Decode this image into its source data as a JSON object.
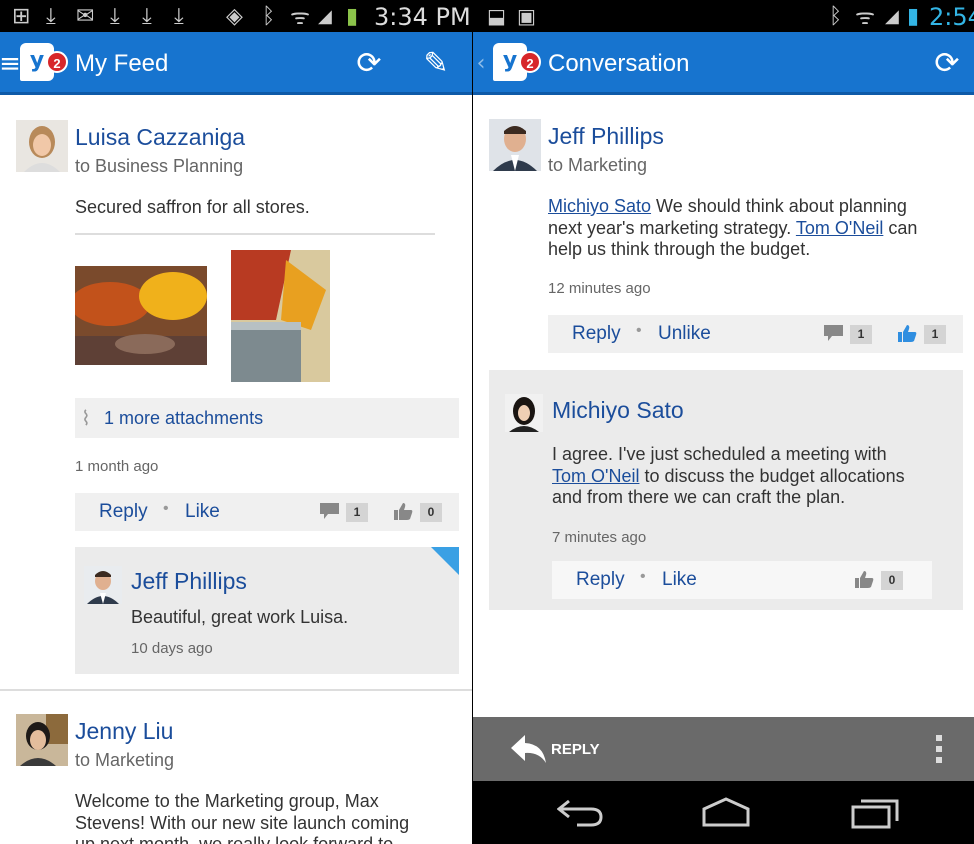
{
  "left": {
    "status": {
      "time": "3:34 PM"
    },
    "actionbar": {
      "badge": "2",
      "title": "My Feed",
      "logo": "y"
    },
    "post1": {
      "author": "Luisa Cazzaniga",
      "group": "to Business Planning",
      "text": "Secured saffron for all stores.",
      "attachments": "1 more attachments",
      "time": "1 month ago",
      "reply_label": "Reply",
      "like_label": "Like",
      "comment_count": "1",
      "like_count": "0",
      "reply": {
        "author": "Jeff Phillips",
        "text": "Beautiful, great work Luisa.",
        "time": "10 days ago"
      }
    },
    "post2": {
      "author": "Jenny Liu",
      "group": "to Marketing",
      "text_line1": "Welcome to the Marketing group, Max",
      "text_line2": "Stevens! With our new site launch coming",
      "text_line3": "up next month, we really look forward to"
    }
  },
  "right": {
    "status": {
      "time": "2:54"
    },
    "actionbar": {
      "badge": "2",
      "title": "Conversation",
      "logo": "y"
    },
    "msg1": {
      "author": "Jeff Phillips",
      "group": "to Marketing",
      "mention1": "Michiyo Sato",
      "text_a": " We should think about planning",
      "text_b": "next year's marketing strategy. ",
      "mention2": "Tom O'Neil",
      "text_c": " can",
      "text_d": "help us think through the budget.",
      "time": "12 minutes ago",
      "reply_label": "Reply",
      "unlike_label": "Unlike",
      "comment_count": "1",
      "like_count": "1"
    },
    "msg2": {
      "author": "Michiyo Sato",
      "text_a": "I agree. I've just scheduled a meeting with",
      "mention": "Tom O'Neil",
      "text_b": " to discuss the budget allocations",
      "text_c": "and from there we can craft the plan.",
      "time": "7 minutes ago",
      "reply_label": "Reply",
      "like_label": "Like",
      "like_count": "0"
    },
    "reply_bar": {
      "label": "REPLY"
    }
  },
  "colors": {
    "actionbar": "#1774cf",
    "link": "#1b4d9b",
    "badge": "#d7262a",
    "reply_bar": "#6a6a6a"
  }
}
